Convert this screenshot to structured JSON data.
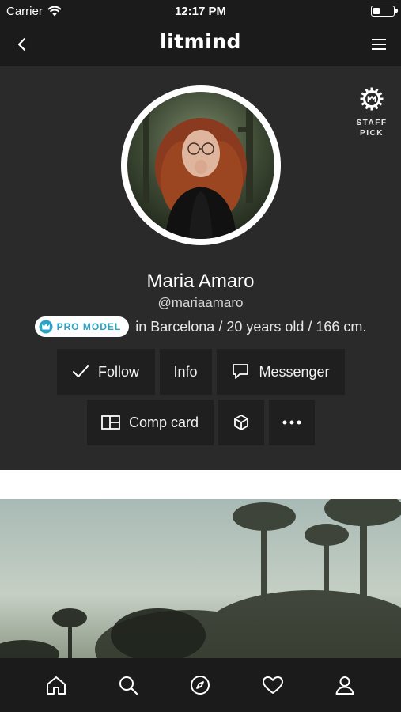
{
  "status_bar": {
    "carrier": "Carrier",
    "time": "12:17 PM",
    "battery_level": 0.35
  },
  "nav": {
    "logo": "litmind"
  },
  "profile": {
    "staff_pick": "STAFF PICK",
    "name": "Maria Amaro",
    "handle": "@mariaamaro",
    "badge": "PRO MODEL",
    "location": "in Barcelona / 20 years old / 166 cm.",
    "buttons": {
      "follow": "Follow",
      "info": "Info",
      "messenger": "Messenger",
      "comp_card": "Comp card"
    }
  },
  "tabs": [
    "home-icon",
    "search-icon",
    "explore-compass-icon",
    "favorites-heart-icon",
    "profile-user-icon"
  ],
  "colors": {
    "background": "#2a2a2a",
    "accent": "#2aa3c7",
    "button": "#1f1f1f"
  }
}
